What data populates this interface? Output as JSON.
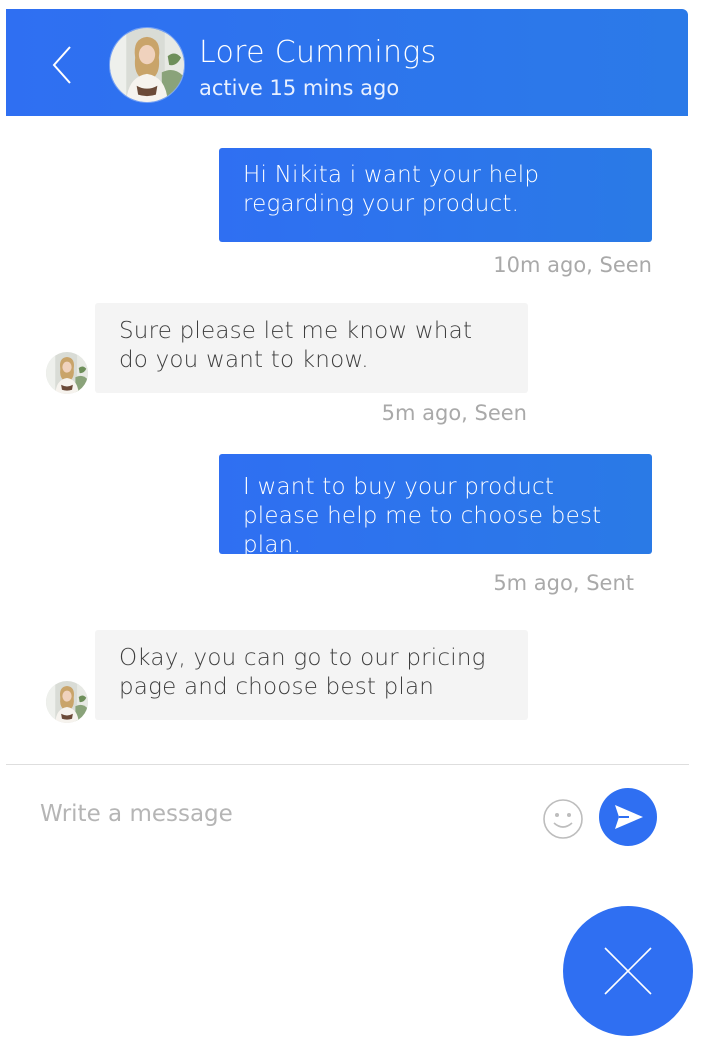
{
  "header": {
    "contact_name": "Lore Cummings",
    "contact_status": "active 15 mins ago"
  },
  "messages": [
    {
      "direction": "outgoing",
      "text": "Hi Nikita i want your help regarding your product.",
      "meta": "10m ago, Seen"
    },
    {
      "direction": "incoming",
      "text": "Sure please let me know what do you want to know.",
      "meta": "5m ago, Seen"
    },
    {
      "direction": "outgoing",
      "text": "I want to buy your product please help me to choose best plan.",
      "meta": "5m ago, Sent"
    },
    {
      "direction": "incoming",
      "text": "Okay, you can go to our pricing page and choose best plan",
      "meta": ""
    }
  ],
  "composer": {
    "placeholder": "Write a message",
    "value": ""
  },
  "icons": {
    "back": "chevron-left-icon",
    "emoji": "smiley-icon",
    "send": "paper-plane-icon",
    "close": "close-icon"
  },
  "colors": {
    "accent": "#2f6ff2",
    "incoming_bubble": "#f4f4f4",
    "meta_text": "#a9a9a9"
  }
}
